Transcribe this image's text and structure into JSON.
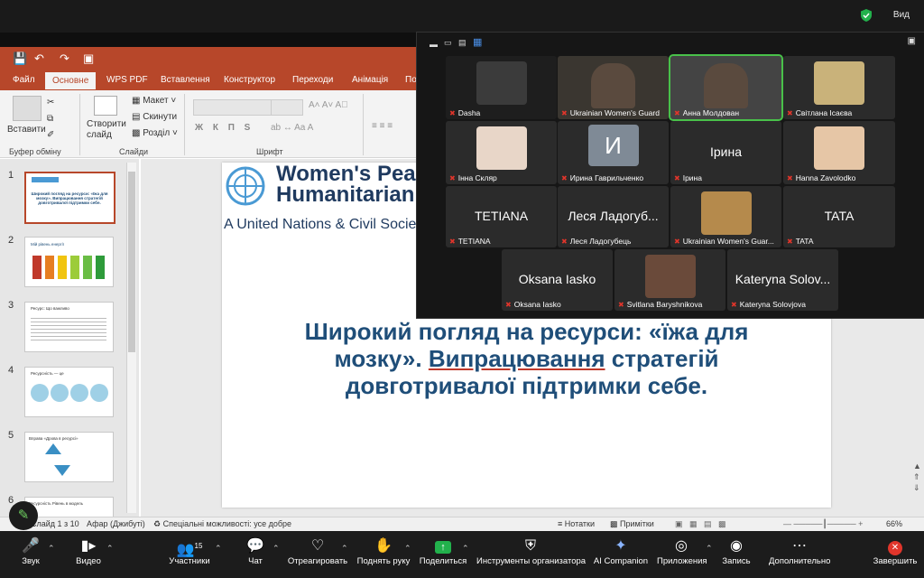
{
  "zoom": {
    "view_label": "Вид",
    "toolbar": {
      "audio": "Звук",
      "video": "Видео",
      "participants": "Участники",
      "participants_count": "15",
      "chat": "Чат",
      "react": "Отреагировать",
      "raise_hand": "Поднять руку",
      "share": "Поделиться",
      "host_tools": "Инструменты организатора",
      "ai_companion": "AI Companion",
      "apps": "Приложения",
      "record": "Запись",
      "more": "Дополнительно",
      "end": "Завершить"
    },
    "tiles": [
      {
        "name": "Dasha",
        "big": ""
      },
      {
        "name": "Ukrainian Women's Guard",
        "big": ""
      },
      {
        "name": "Анна Молдован",
        "big": "",
        "active": true
      },
      {
        "name": "Світлана Ісаєва",
        "big": ""
      },
      {
        "name": "Інна Скляр",
        "big": ""
      },
      {
        "name": "Ирина Гаврильченко",
        "big": "И"
      },
      {
        "name": "Ірина",
        "big": "Ірина"
      },
      {
        "name": "Hanna Zavolodko",
        "big": ""
      },
      {
        "name": "TETIANA",
        "big": "TETIANA"
      },
      {
        "name": "Леся Ладогубець",
        "big": "Леся Ладогуб..."
      },
      {
        "name": "Ukrainian Women's Guar...",
        "big": ""
      },
      {
        "name": "TATA",
        "big": "TATA"
      },
      {
        "name": "Oksana Iasko",
        "big": "Oksana Iasko"
      },
      {
        "name": "Svitlana Baryshnikova",
        "big": ""
      },
      {
        "name": "Kateryna Solovjova",
        "big": "Kateryna Solov..."
      }
    ],
    "colors": {
      "active_border": "#49c14a",
      "end": "#e0352b",
      "share": "#22b14c"
    }
  },
  "ppt": {
    "menu": [
      "Файл",
      "Основне",
      "WPS PDF",
      "Вставлення",
      "Конструктор",
      "Переходи",
      "Анімація",
      "По"
    ],
    "active_menu": "Основне",
    "ribbon": {
      "paste": "Вставити",
      "clipboard_group": "Буфер обміну",
      "create_slide": "Створити слайд",
      "layout": "Макет",
      "reset": "Скинути",
      "section": "Розділ",
      "slides_group": "Слайди",
      "font_group": "Шрифт",
      "format_letters": "Ж К П S"
    },
    "thumbnails": [
      {
        "num": "1",
        "title": "Широкий погляд на ресурси: «їжа для мозку». Випрацювання стратегій довготривалої підтримки себе."
      },
      {
        "num": "2",
        "title": "Мій рівень енергії"
      },
      {
        "num": "3",
        "title": "Ресурс: Що важливо"
      },
      {
        "num": "4",
        "title": "Ресурсність — це"
      },
      {
        "num": "5",
        "title": "Вправа «Дрова в ресурсі»"
      },
      {
        "num": "6",
        "title": "Ресурсність Рівень в модель"
      }
    ],
    "slide": {
      "logo_line1": "Women's Peac",
      "logo_line2": "Humanitarian",
      "subtitle": "A United Nations & Civil Society",
      "title_line1": "Широкий погляд на ресурси: «їжа для",
      "title_line2_a": "мозку». ",
      "title_line2_b": "Випрацювання",
      "title_line2_c": " стратегій",
      "title_line3": "довготривалої підтримки себе."
    },
    "status": {
      "slide_info": "Слайд 1 з 10",
      "language": "Афар (Джибуті)",
      "accessibility": "Спеціальні можливості: усе добре",
      "notes": "Нотатки",
      "comments": "Примітки",
      "zoom": "66%"
    },
    "colors": {
      "accent": "#b7472a",
      "slide_title": "#1f4e79",
      "un_blue": "#4a9ad4"
    }
  }
}
